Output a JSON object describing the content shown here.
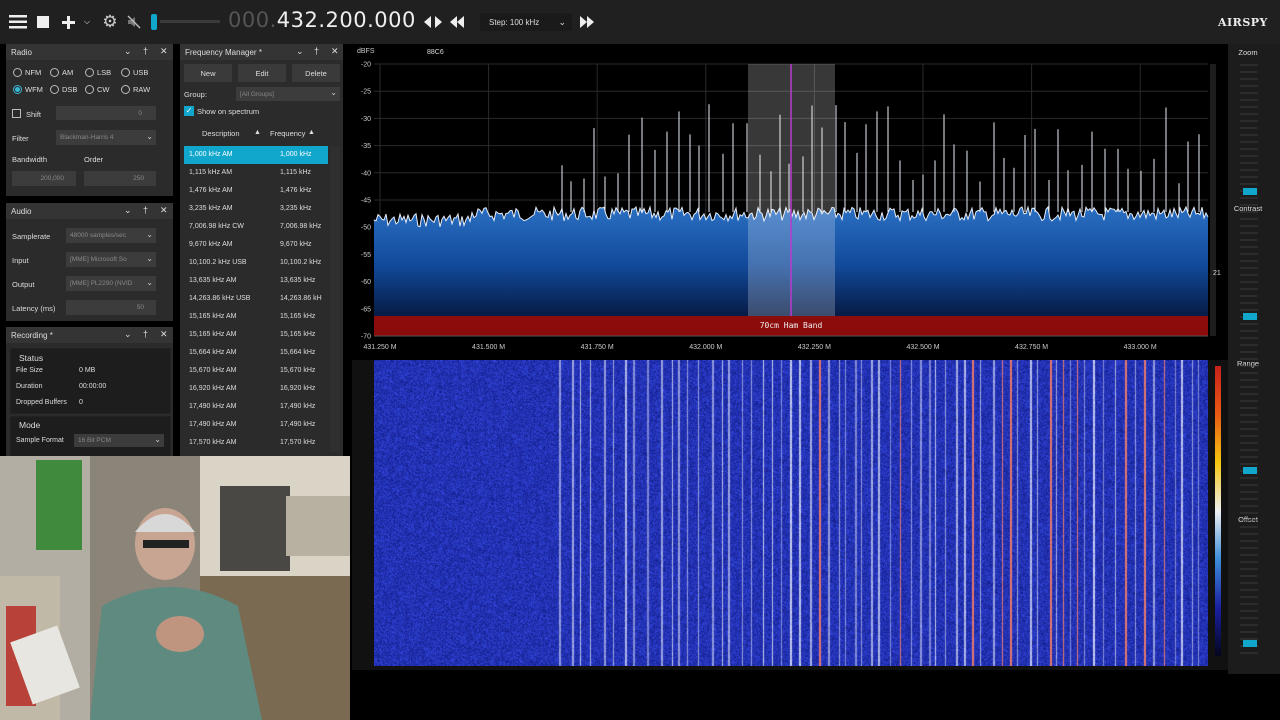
{
  "toolbar": {
    "frequency_prefix": "000.",
    "frequency_main": "432.200.000",
    "step_label": "Step: 100 kHz",
    "logo": "AIRSPY"
  },
  "radio_panel": {
    "title": "Radio",
    "modes": [
      "NFM",
      "AM",
      "LSB",
      "USB",
      "WFM",
      "DSB",
      "CW",
      "RAW"
    ],
    "selected_mode": "WFM",
    "shift_label": "Shift",
    "shift_value": "0",
    "filter_label": "Filter",
    "filter_value": "Blackman-Harris 4",
    "bandwidth_label": "Bandwidth",
    "bandwidth_value": "200,000",
    "order_label": "Order",
    "order_value": "250"
  },
  "audio_panel": {
    "title": "Audio",
    "samplerate_label": "Samplerate",
    "samplerate_value": "48000 samples/sec",
    "input_label": "Input",
    "input_value": "[MME] Microsoft So",
    "output_label": "Output",
    "output_value": "[MME] PL2290 (NVID",
    "latency_label": "Latency (ms)",
    "latency_value": "50"
  },
  "recording_panel": {
    "title": "Recording *",
    "status_title": "Status",
    "file_size_label": "File Size",
    "file_size_value": "0 MB",
    "duration_label": "Duration",
    "duration_value": "00:00:00",
    "dropped_label": "Dropped Buffers",
    "dropped_value": "0",
    "mode_title": "Mode",
    "sample_format_label": "Sample Format",
    "sample_format_value": "16 Bit PCM"
  },
  "freq_manager": {
    "title": "Frequency Manager *",
    "new_label": "New",
    "edit_label": "Edit",
    "delete_label": "Delete",
    "group_label": "Group:",
    "group_value": "[All Groups]",
    "show_label": "Show on spectrum",
    "col_description": "Description",
    "col_frequency": "Frequency",
    "rows": [
      {
        "desc": "1,000 kHz AM",
        "freq": "1,000 kHz"
      },
      {
        "desc": "1,115 kHz AM",
        "freq": "1,115 kHz"
      },
      {
        "desc": "1,476 kHz AM",
        "freq": "1,476 kHz"
      },
      {
        "desc": "3,235 kHz AM",
        "freq": "3,235 kHz"
      },
      {
        "desc": "7,006.98 kHz CW",
        "freq": "7,006.98 kHz"
      },
      {
        "desc": "9,670 kHz AM",
        "freq": "9,670 kHz"
      },
      {
        "desc": "10,100.2 kHz USB",
        "freq": "10,100.2 kHz"
      },
      {
        "desc": "13,635 kHz AM",
        "freq": "13,635 kHz"
      },
      {
        "desc": "14,263.86 kHz USB",
        "freq": "14,263.86 kH"
      },
      {
        "desc": "15,165 kHz AM",
        "freq": "15,165 kHz"
      },
      {
        "desc": "15,165 kHz AM",
        "freq": "15,165 kHz"
      },
      {
        "desc": "15,664 kHz AM",
        "freq": "15,664 kHz"
      },
      {
        "desc": "15,670 kHz AM",
        "freq": "15,670 kHz"
      },
      {
        "desc": "16,920 kHz AM",
        "freq": "16,920 kHz"
      },
      {
        "desc": "17,490 kHz AM",
        "freq": "17,490 kHz"
      },
      {
        "desc": "17,490 kHz AM",
        "freq": "17,490 kHz"
      },
      {
        "desc": "17,570 kHz AM",
        "freq": "17,570 kHz"
      }
    ]
  },
  "spectrum": {
    "unit_label": "dBFS",
    "top_label": "88C6",
    "db_ticks": [
      "-20",
      "-25",
      "-30",
      "-35",
      "-40",
      "-45",
      "-50",
      "-55",
      "-60",
      "-65",
      "-70"
    ],
    "freq_ticks": [
      "431.250 M",
      "431.500 M",
      "431.750 M",
      "432.000 M",
      "432.250 M",
      "432.500 M",
      "432.750 M",
      "433.000 M"
    ],
    "band_label": "70cm Ham Band",
    "scale_value": "21"
  },
  "sidebar": {
    "zoom_label": "Zoom",
    "contrast_label": "Contrast",
    "range_label": "Range",
    "offset_label": "Offset"
  }
}
